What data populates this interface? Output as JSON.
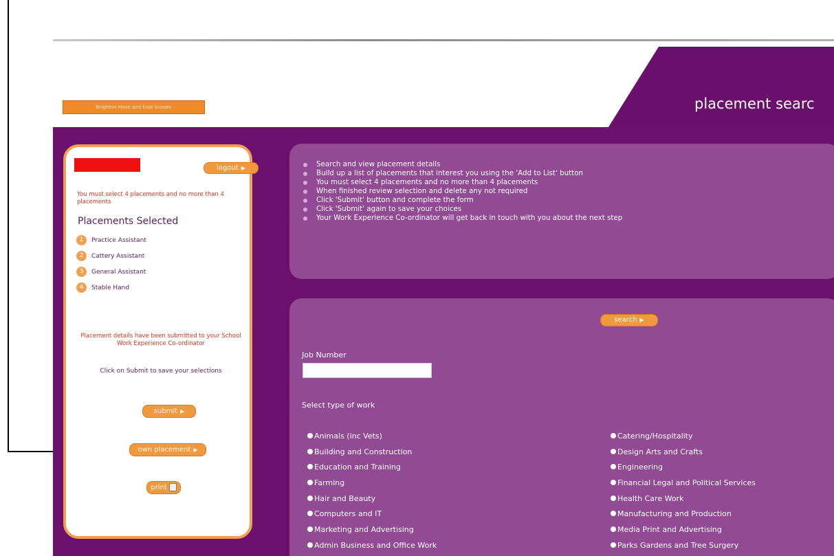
{
  "header": {
    "brand_button": "Brighton Hove and East Sussex",
    "title": "placement searc"
  },
  "sidebar": {
    "logout_label": "logout",
    "warning": "You must select 4 placements and no more than 4 placements",
    "selected_heading": "Placements Selected",
    "selected": [
      {
        "num": "1",
        "label": "Practice Assistant"
      },
      {
        "num": "2",
        "label": "Cattery Assistant"
      },
      {
        "num": "3",
        "label": "General Assistant"
      },
      {
        "num": "4",
        "label": "Stable Hand"
      }
    ],
    "submitted_msg": "Placement details have been submitted to your School Work Experience Co-ordinator",
    "click_msg": "Click on Submit to save your selections",
    "submit_label": "submit",
    "own_placement_label": "own placement",
    "print_label": "print"
  },
  "instructions": [
    "Search and view placement details",
    "Build up a list of placements that interest you using the 'Add to List' button",
    "You must select 4 placements and no more than 4 placements",
    "When finished review selection and delete any not required",
    "Click 'Submit' button and complete the form",
    "Click 'Submit' again to save your choices",
    "Your Work Experience Co-ordinator will get back in touch with you about the next step"
  ],
  "search": {
    "button_label": "search",
    "job_number_label": "Job Number",
    "job_number_value": "",
    "type_label": "Select type of work",
    "left_types": [
      "Animals (inc Vets)",
      "Building and Construction",
      "Education and Training",
      "Farming",
      "Hair and Beauty",
      "Computers and IT",
      "Marketing and Advertising",
      "Admin Business and Office Work"
    ],
    "right_types": [
      "Catering/Hospitality",
      "Design Arts and Crafts",
      "Engineering",
      "Financial Legal and Political Services",
      "Health Care Work",
      "Manufacturing and Production",
      "Media Print and Advertising",
      "Parks Gardens and Tree Surgery"
    ]
  },
  "colors": {
    "purple_dark": "#6c106d",
    "purple_panel": "#914a93",
    "orange": "#f09a40"
  }
}
